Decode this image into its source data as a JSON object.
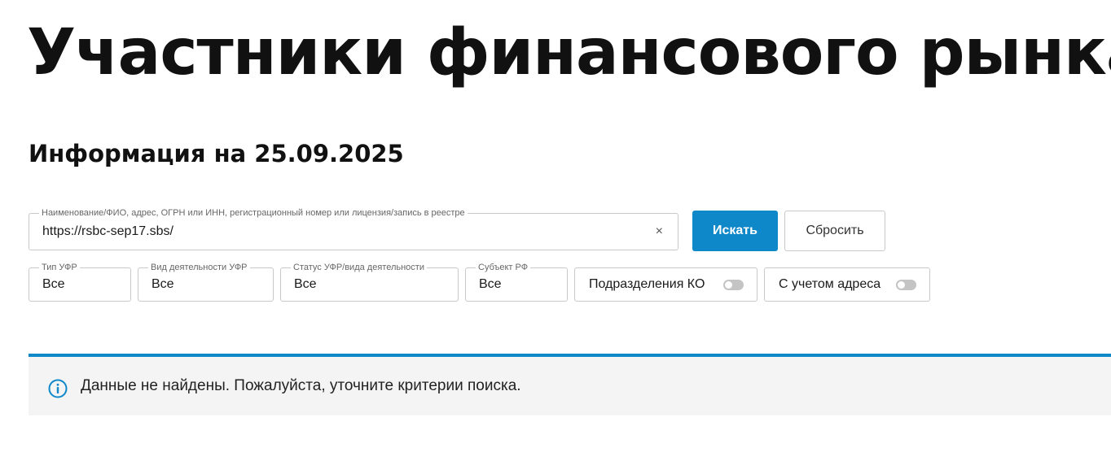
{
  "page": {
    "title": "Участники финансового рынка",
    "info_date": "Информация на 25.09.2025"
  },
  "search": {
    "legend": "Наименование/ФИО, адрес, ОГРН или ИНН, регистрационный номер или лицензия/запись в реестре",
    "value": "https://rsbc-sep17.sbs/",
    "clear_icon": "×",
    "search_label": "Искать",
    "reset_label": "Сбросить"
  },
  "filters": {
    "type": {
      "legend": "Тип УФР",
      "value": "Все"
    },
    "activity": {
      "legend": "Вид деятельности УФР",
      "value": "Все"
    },
    "status": {
      "legend": "Статус УФР/вида деятельности",
      "value": "Все"
    },
    "region": {
      "legend": "Субъект РФ",
      "value": "Все"
    }
  },
  "toggles": {
    "ko_units": {
      "label": "Подразделения КО",
      "on": false
    },
    "with_address": {
      "label": "С учетом адреса",
      "on": false
    }
  },
  "alert": {
    "message": "Данные не найдены. Пожалуйста, уточните критерии поиска.",
    "icon": "info-icon"
  },
  "colors": {
    "accent": "#0f88c9",
    "alert_bg": "#f4f4f4",
    "border": "#c9c9c9"
  }
}
